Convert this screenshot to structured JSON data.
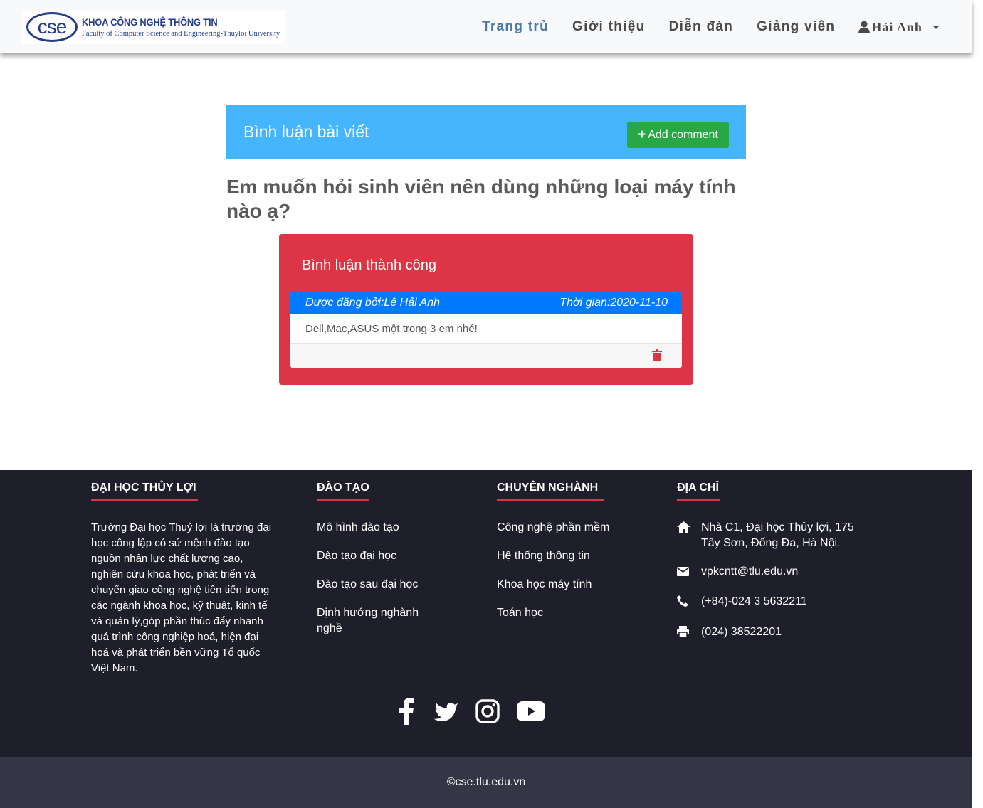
{
  "navbar": {
    "logo": {
      "mark": "cse",
      "title": "KHOA CÔNG NGHỆ THÔNG TIN",
      "subtitle": "Faculty of Computer Science and Engineering-Thuyloi University"
    },
    "links": [
      {
        "label": "Trang trủ",
        "active": true
      },
      {
        "label": "Giới thiệu"
      },
      {
        "label": "Diễn đàn"
      },
      {
        "label": "Giảng viên"
      }
    ],
    "user": {
      "name": "Hải Anh"
    }
  },
  "post": {
    "header_title": "Bình luận bài viết",
    "add_button": "Add comment",
    "question": "Em muốn hỏi sinh viên nên dùng những loại máy tính nào ạ?"
  },
  "panel": {
    "title": "Bình luận thành công",
    "comment": {
      "author": "Được đăng bởi:Lê Hải Anh",
      "time": "Thời gian:2020-11-10",
      "body": "Dell,Mac,ASUS một trong 3 em nhé!"
    }
  },
  "footer": {
    "about": {
      "heading": "ĐẠI HỌC THỦY LỢI",
      "text": "Trường Đại học Thuỷ lợi là trường đại học công lập có sứ mệnh đào tạo nguồn nhân lực chất lượng cao, nghiên cứu khoa học, phát triển và chuyển giao công nghệ tiên tiến trong các ngành khoa học, kỹ thuật, kinh tế và quản lý,góp phần thúc đẩy nhanh quá trình công nghiệp hoá, hiện đại hoá và phát triển bền vững Tổ quốc Việt Nam."
    },
    "training": {
      "heading": "ĐÀO TẠO",
      "items": [
        "Mô hình đào tạo",
        "Đào tạo đại học",
        "Đào tạo sau đại học",
        "Định hướng nghành nghề"
      ]
    },
    "majors": {
      "heading": "CHUYÊN NGHÀNH",
      "items": [
        "Công nghệ phần mềm",
        "Hệ thống thông tin",
        "Khoa học máy tính",
        "Toán học"
      ]
    },
    "address": {
      "heading": "ĐỊA CHỈ",
      "location": "Nhà C1, Đại học Thủy lợi, 175 Tây Sơn, Đống Đa, Hà Nội.",
      "email": "vpkcntt@tlu.edu.vn",
      "phone": "(+84)-024 3 5632211",
      "fax": "(024) 38522201"
    },
    "socials": [
      "facebook-icon",
      "twitter-icon",
      "instagram-icon",
      "youtube-icon"
    ],
    "copyright": "©cse.tlu.edu.vn"
  },
  "colors": {
    "header_blue": "#45b6fe",
    "success_green": "#28a745",
    "panel_red": "#dc3545",
    "comment_blue": "#007bff",
    "footer_dark": "#1e1f2a",
    "copyright_bar": "#343545"
  }
}
